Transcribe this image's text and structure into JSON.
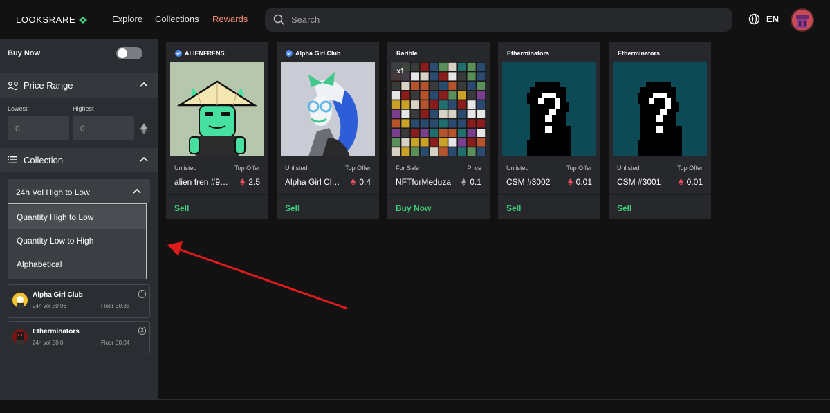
{
  "header": {
    "logo_text": "LOOKSRARE",
    "nav": [
      "Explore",
      "Collections",
      "Rewards"
    ],
    "search_placeholder": "Search",
    "language": "EN"
  },
  "sidebar": {
    "buy_now_label": "Buy Now",
    "buy_now_enabled": false,
    "price_range_title": "Price Range",
    "lowest_label": "Lowest",
    "highest_label": "Highest",
    "lowest_placeholder": "0",
    "highest_placeholder": "0",
    "collection_title": "Collection",
    "sort_selected": "24h Vol High to Low",
    "sort_options": [
      "Quantity High to Low",
      "Quantity Low to High",
      "Alphabetical"
    ],
    "collections": [
      {
        "name": "Alpha Girl Club",
        "vol": "24h vol Ξ0.96",
        "floor": "Floor Ξ0.38",
        "count": "1"
      },
      {
        "name": "Etherminators",
        "vol": "24h vol Ξ0.0",
        "floor": "Floor Ξ0.04",
        "count": "2"
      }
    ]
  },
  "cards": [
    {
      "collection": "ALIENFRENS",
      "verified": true,
      "status": "Unlisted",
      "price_label": "Top Offer",
      "name": "alien fren #9…",
      "price": "2.5",
      "action": "Sell"
    },
    {
      "collection": "Alpha Girl Club",
      "verified": true,
      "status": "Unlisted",
      "price_label": "Top Offer",
      "name": "Alpha Girl Cl…",
      "price": "0.4",
      "action": "Sell"
    },
    {
      "collection": "Rarible",
      "verified": false,
      "status": "For Sale",
      "price_label": "Price",
      "name": "NFTforMeduza",
      "price": "0.1",
      "action": "Buy Now",
      "badge": "x1"
    },
    {
      "collection": "Etherminators",
      "verified": false,
      "status": "Unlisted",
      "price_label": "Top Offer",
      "name": "CSM #3002",
      "price": "0.01",
      "action": "Sell"
    },
    {
      "collection": "Etherminators",
      "verified": false,
      "status": "Unlisted",
      "price_label": "Top Offer",
      "name": "CSM #3001",
      "price": "0.01",
      "action": "Sell"
    }
  ],
  "colors": {
    "accent_green": "#3fcf7b",
    "rewards_orange": "#f38b6f",
    "offer_red": "#e8505b"
  }
}
